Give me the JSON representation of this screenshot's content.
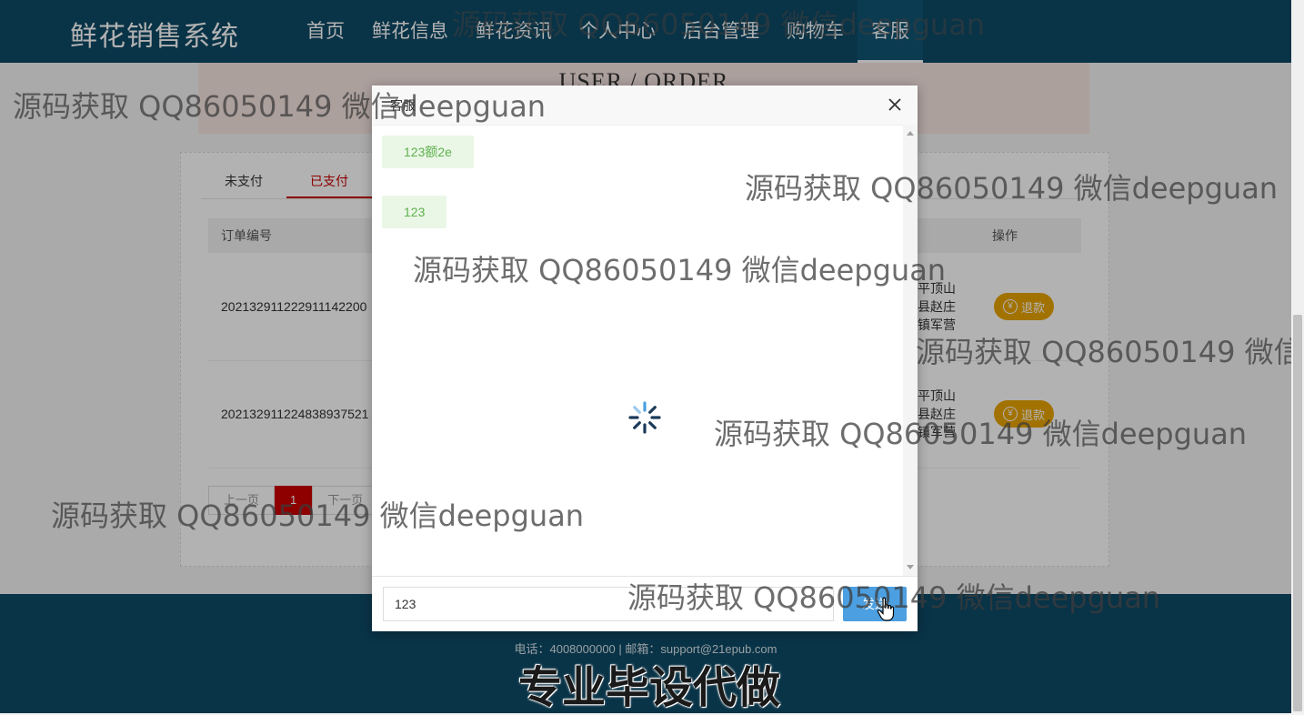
{
  "header": {
    "brand": "鲜花销售系统",
    "nav": [
      {
        "label": "首页",
        "active": false
      },
      {
        "label": "鲜花信息",
        "active": false
      },
      {
        "label": "鲜花资讯",
        "active": false
      },
      {
        "label": "个人中心",
        "active": false
      },
      {
        "label": "后台管理",
        "active": false
      },
      {
        "label": "购物车",
        "active": false
      },
      {
        "label": "客服",
        "active": true
      }
    ]
  },
  "banner": {
    "title": "USER / ORDER"
  },
  "orders": {
    "tabs": [
      "未支付",
      "已支付"
    ],
    "active_tab": "已支付",
    "columns": {
      "order_no": "订单编号",
      "action": "操作"
    },
    "rows": [
      {
        "order_no": "20213291122291114220​0",
        "address": "平顶山县赵庄镇军营",
        "action": "退款"
      },
      {
        "order_no": "20213291122483893752​1",
        "address": "平顶山县赵庄镇军营",
        "action": "退款"
      }
    ],
    "pager": {
      "prev": "上一页",
      "current": "1",
      "next": "下一页"
    }
  },
  "footer": {
    "contact": "电话：4008000000 | 邮箱：support@21epub.com"
  },
  "dialog": {
    "title": "客服",
    "messages": [
      "123额2e",
      "123"
    ],
    "input_value": "123",
    "send_label": "发送"
  },
  "watermark": {
    "text": "源码获取 QQ86050149 微信deepguan",
    "big": "专业毕设代做"
  },
  "colors": {
    "header_bg": "#0d4a66",
    "accent_red": "#cc0000",
    "refund_yellow": "#e8a400",
    "send_blue": "#4c9fe0",
    "bubble_green": "#5fb04f"
  }
}
